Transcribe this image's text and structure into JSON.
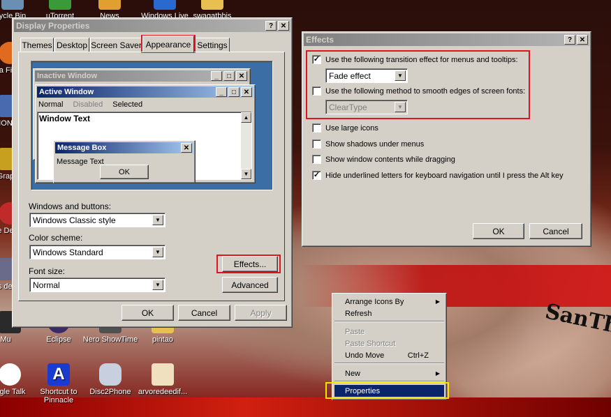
{
  "desktop": {
    "icons": [
      {
        "label": "ycle Bin"
      },
      {
        "label": "uTorrent"
      },
      {
        "label": "News"
      },
      {
        "label": "Windows Live"
      },
      {
        "label": "swagatbhis"
      },
      {
        "label": "a Fi"
      },
      {
        "label": "ION"
      },
      {
        "label": "Grap"
      },
      {
        "label": "e De"
      },
      {
        "label": "ows des"
      },
      {
        "label": "Mu"
      },
      {
        "label": "Eclipse"
      },
      {
        "label": "Nero ShowTime"
      },
      {
        "label": "pintao"
      },
      {
        "label": "gle Talk"
      },
      {
        "label": "Shortcut to Pinnacle"
      },
      {
        "label": "Disc2Phone"
      },
      {
        "label": "arvoredeedif..."
      }
    ],
    "tattoo_text": "SanTh"
  },
  "display_properties": {
    "title": "Display Properties",
    "help_btn": "?",
    "close_btn": "✕",
    "tabs": [
      {
        "label": "Themes"
      },
      {
        "label": "Desktop"
      },
      {
        "label": "Screen Saver"
      },
      {
        "label": "Appearance"
      },
      {
        "label": "Settings"
      }
    ],
    "preview": {
      "inactive_title": "Inactive Window",
      "active_title": "Active Window",
      "menu_normal": "Normal",
      "menu_disabled": "Disabled",
      "menu_selected": "Selected",
      "window_text": "Window Text",
      "msgbox_title": "Message Box",
      "msgbox_text": "Message Text",
      "msgbox_ok": "OK"
    },
    "windows_and_buttons_label": "Windows and buttons:",
    "windows_and_buttons_value": "Windows Classic style",
    "color_scheme_label": "Color scheme:",
    "color_scheme_value": "Windows Standard",
    "font_size_label": "Font size:",
    "font_size_value": "Normal",
    "effects_btn": "Effects...",
    "advanced_btn": "Advanced",
    "ok_btn": "OK",
    "cancel_btn": "Cancel",
    "apply_btn": "Apply"
  },
  "effects": {
    "title": "Effects",
    "help_btn": "?",
    "close_btn": "✕",
    "opt_transition": {
      "label": "Use the following transition effect for menus and tooltips:",
      "checked": "✓"
    },
    "transition_value": "Fade effect",
    "opt_smooth": {
      "label": "Use the following method to smooth edges of screen fonts:",
      "checked": ""
    },
    "smooth_value": "ClearType",
    "opt_large_icons": {
      "label": "Use large icons",
      "checked": ""
    },
    "opt_shadows": {
      "label": "Show shadows under menus",
      "checked": ""
    },
    "opt_drag": {
      "label": "Show window contents while dragging",
      "checked": ""
    },
    "opt_underline": {
      "label": "Hide underlined letters for keyboard navigation until I press the Alt key",
      "checked": "✓"
    },
    "ok_btn": "OK",
    "cancel_btn": "Cancel"
  },
  "context_menu": {
    "arrange": "Arrange Icons By",
    "refresh": "Refresh",
    "paste": "Paste",
    "paste_shortcut": "Paste Shortcut",
    "undo_move": "Undo Move",
    "undo_shortcut": "Ctrl+Z",
    "new": "New",
    "properties": "Properties",
    "submenu_arrow": "▶"
  },
  "colors": {
    "highlight_red": "#e0141e",
    "highlight_yellow": "#f2e600",
    "title_active": "#0a246a",
    "face": "#d4d0c8"
  }
}
